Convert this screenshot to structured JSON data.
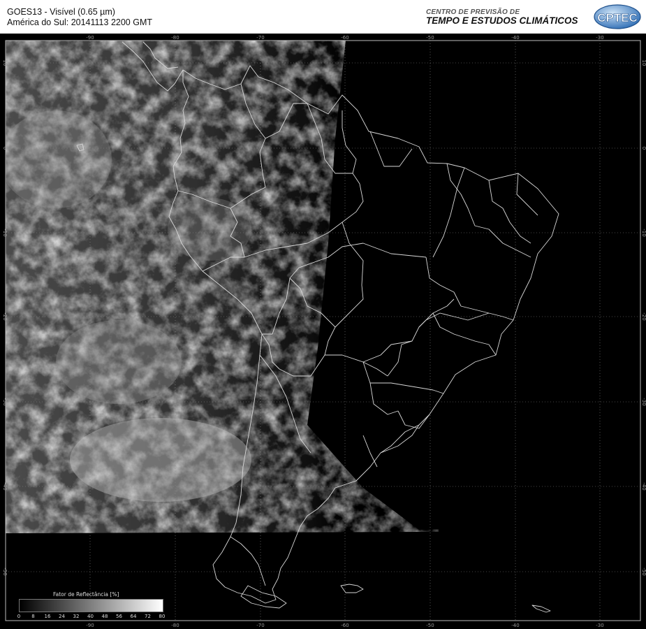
{
  "header": {
    "line1": "GOES13 - Visível (0.65 µm)",
    "line2": "América do Sul: 20141113 2200 GMT",
    "org_small": "CENTRO DE PREVISÃO DE",
    "org_big": "TEMPO E ESTUDOS CLIMÁTICOS",
    "logo_text": "CPTEC"
  },
  "map": {
    "lon_ticks": [
      "-90",
      "-80",
      "-70",
      "-60",
      "-50",
      "-40",
      "-30"
    ],
    "lat_ticks": [
      "10",
      "0",
      "-10",
      "-20",
      "-30",
      "-40",
      "-50"
    ],
    "grid": true
  },
  "colorbar": {
    "title": "Fator de Reflectância [%]",
    "labels": [
      "0",
      "8",
      "16",
      "24",
      "32",
      "40",
      "48",
      "56",
      "64",
      "72",
      "80"
    ]
  }
}
